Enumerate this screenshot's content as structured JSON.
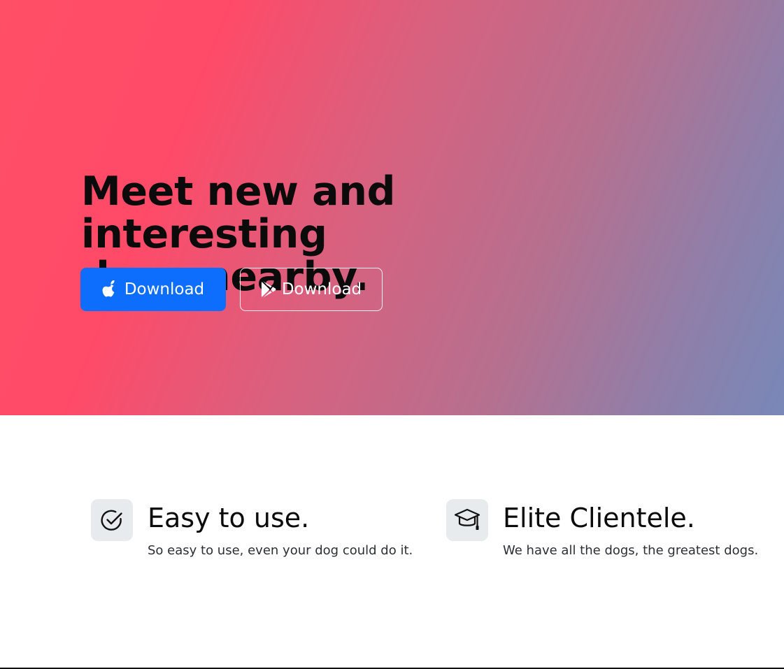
{
  "hero": {
    "title_line1": "Meet new and interesting",
    "title_line2": "dogs nearby.",
    "buttons": [
      {
        "label": "Download",
        "icon": "apple-icon",
        "color": "#0d6efd"
      },
      {
        "label": "Download",
        "icon": "google-play-icon",
        "color": "transparent"
      }
    ],
    "gradient_colors": [
      "#ff4a68",
      "#c96b88",
      "#7888b8"
    ]
  },
  "features": [
    {
      "title": "Easy to use.",
      "text": "So easy to use, even your dog could do it.",
      "icon": "check-circle-icon"
    },
    {
      "title": "Elite Clientele.",
      "text": "We have all the dogs, the greatest dogs.",
      "icon": "mortarboard-icon"
    }
  ]
}
